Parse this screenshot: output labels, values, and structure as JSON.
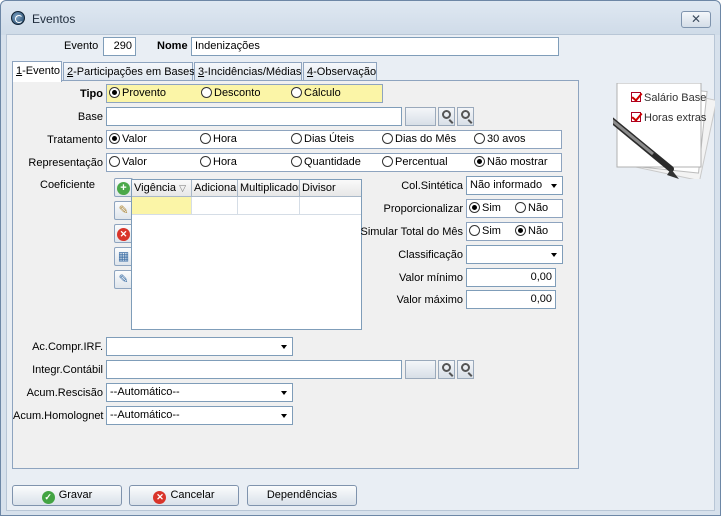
{
  "window": {
    "title": "Eventos",
    "close_icon": "close-icon"
  },
  "header": {
    "evento_label": "Evento",
    "evento_value": "290",
    "nome_label": "Nome",
    "nome_value": "Indenizações"
  },
  "tabs": [
    {
      "key": "1",
      "rest": "-Evento"
    },
    {
      "key": "2",
      "rest": "-Participações em Bases"
    },
    {
      "key": "3",
      "rest": "-Incidências/Médias"
    },
    {
      "key": "4",
      "rest": "-Observação"
    }
  ],
  "form": {
    "tipo": {
      "label": "Tipo",
      "options": [
        "Provento",
        "Desconto",
        "Cálculo"
      ],
      "selected": "Provento"
    },
    "base": {
      "label": "Base",
      "value": ""
    },
    "tratamento": {
      "label": "Tratamento",
      "options": [
        "Valor",
        "Hora",
        "Dias Úteis",
        "Dias do Mês",
        "30 avos"
      ],
      "selected": "Valor"
    },
    "representacao": {
      "label": "Representação",
      "options": [
        "Valor",
        "Hora",
        "Quantidade",
        "Percentual",
        "Não mostrar"
      ],
      "selected": "Não mostrar"
    },
    "coeficiente": {
      "label": "Coeficiente",
      "columns": [
        "Vigência",
        "Adicional",
        "Multiplicador",
        "Divisor"
      ]
    },
    "col_sintetica": {
      "label": "Col.Sintética",
      "value": "Não informado"
    },
    "proporcionalizar": {
      "label": "Proporcionalizar",
      "options": [
        "Sim",
        "Não"
      ],
      "selected": "Sim"
    },
    "simular": {
      "label": "Simular Total do Mês",
      "options": [
        "Sim",
        "Não"
      ],
      "selected": "Não"
    },
    "classificacao": {
      "label": "Classificação",
      "value": ""
    },
    "valor_minimo": {
      "label": "Valor mínimo",
      "value": "0,00"
    },
    "valor_maximo": {
      "label": "Valor máximo",
      "value": "0,00"
    },
    "ac_compr_irf": {
      "label": "Ac.Compr.IRF.",
      "value": ""
    },
    "integr_contabil": {
      "label": "Integr.Contábil",
      "value": ""
    },
    "acum_rescisao": {
      "label": "Acum.Rescisão",
      "value": "--Automático--"
    },
    "acum_homolognet": {
      "label": "Acum.Homolognet",
      "value": "--Automático--"
    }
  },
  "note": {
    "items": [
      "Salário Base",
      "Horas extras"
    ]
  },
  "buttons": {
    "gravar": "Gravar",
    "cancelar": "Cancelar",
    "dependencias": "Dependências"
  }
}
